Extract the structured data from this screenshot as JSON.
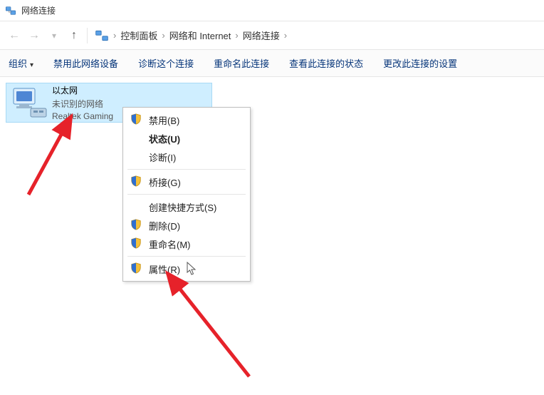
{
  "window": {
    "title": "网络连接"
  },
  "breadcrumbs": {
    "items": [
      "控制面板",
      "网络和 Internet",
      "网络连接"
    ]
  },
  "toolbar": {
    "organize": "组织",
    "disable_device": "禁用此网络设备",
    "diagnose": "诊断这个连接",
    "rename": "重命名此连接",
    "view_status": "查看此连接的状态",
    "change_settings": "更改此连接的设置"
  },
  "connection": {
    "name": "以太网",
    "status": "未识别的网络",
    "adapter": "Realtek Gaming"
  },
  "context_menu": {
    "disable": "禁用(B)",
    "status": "状态(U)",
    "diagnose": "诊断(I)",
    "bridge": "桥接(G)",
    "shortcut": "创建快捷方式(S)",
    "delete": "删除(D)",
    "rename": "重命名(M)",
    "properties": "属性(R)"
  }
}
